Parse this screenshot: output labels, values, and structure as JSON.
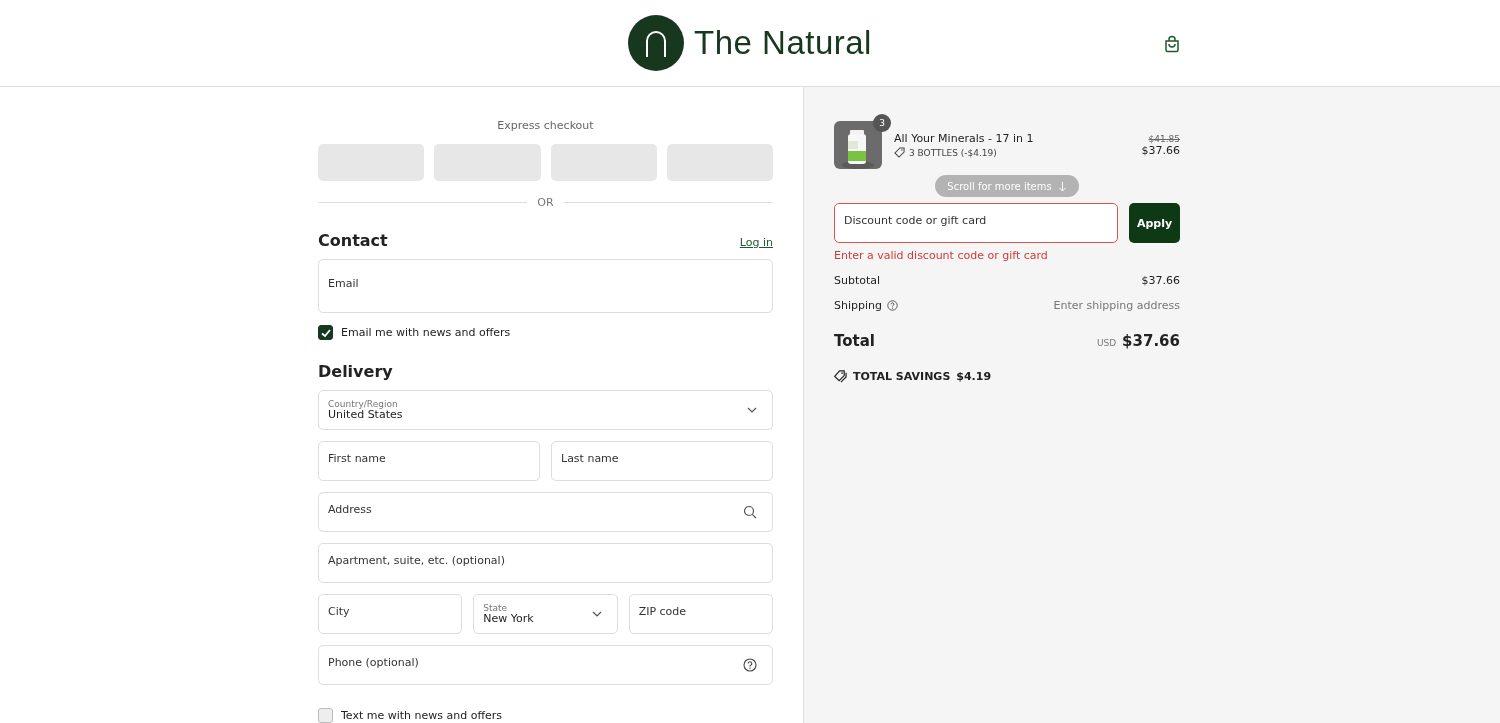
{
  "header": {
    "brand": "The Natural"
  },
  "express_checkout": {
    "title": "Express checkout",
    "buttons": [
      {
        "loading": true
      },
      {
        "loading": true
      },
      {
        "loading": true
      },
      {
        "loading": true
      }
    ],
    "divider": "OR"
  },
  "contact": {
    "title": "Contact",
    "login_link": "Log in",
    "email": {
      "placeholder": "Email"
    },
    "newsletter": {
      "label": "Email me with news and offers",
      "checked": true
    }
  },
  "delivery": {
    "title": "Delivery",
    "rows": [
      [
        {
          "kind": "select",
          "label": "Country/Region",
          "value": "United States"
        }
      ],
      [
        {
          "kind": "text",
          "placeholder": "First name"
        },
        {
          "kind": "text",
          "placeholder": "Last name"
        }
      ],
      [
        {
          "kind": "search",
          "placeholder": "Address"
        }
      ],
      [
        {
          "kind": "text",
          "placeholder": "Apartment, suite, etc. (optional)"
        }
      ],
      [
        {
          "kind": "text",
          "placeholder": "City"
        },
        {
          "kind": "select",
          "label": "State",
          "value": "New York"
        },
        {
          "kind": "text",
          "placeholder": "ZIP code"
        }
      ],
      [
        {
          "kind": "help",
          "placeholder": "Phone (optional)"
        }
      ]
    ],
    "sms": {
      "label": "Text me with news and offers",
      "checked": false
    }
  },
  "summary": {
    "items": [
      {
        "quantity": "3",
        "name": "All Your Minerals - 17 in 1",
        "discount": "3 BOTTLES (-$4.19)",
        "original_price": "$41.85",
        "price": "$37.66"
      }
    ],
    "scroll_hint": "Scroll for more items",
    "discount": {
      "placeholder": "Discount code or gift card",
      "button": "Apply",
      "error": "Enter a valid discount code or gift card"
    },
    "subtotal": {
      "label": "Subtotal",
      "value": "$37.66"
    },
    "shipping": {
      "label": "Shipping",
      "value": "Enter shipping address"
    },
    "total": {
      "label": "Total",
      "currency": "USD",
      "value": "$37.66"
    },
    "savings": {
      "label": "TOTAL SAVINGS",
      "value": "$4.19"
    }
  }
}
